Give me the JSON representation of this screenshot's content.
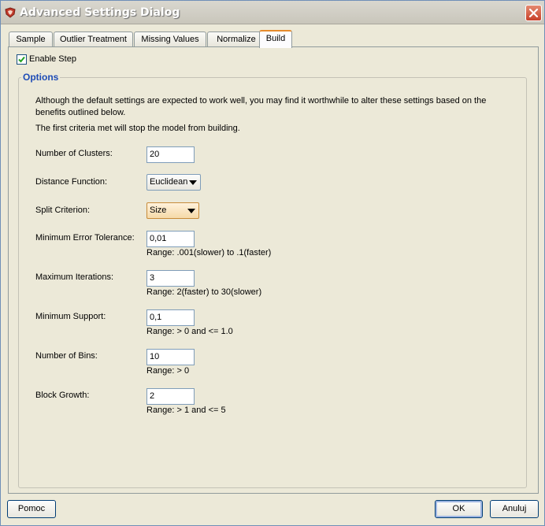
{
  "window": {
    "title": "Advanced Settings Dialog"
  },
  "tabs": [
    {
      "label": "Sample"
    },
    {
      "label": "Outlier Treatment"
    },
    {
      "label": "Missing Values"
    },
    {
      "label": "Normalize"
    },
    {
      "label": "Build",
      "active": true
    }
  ],
  "enable_step": {
    "label": "Enable Step",
    "checked": true
  },
  "options": {
    "title": "Options",
    "intro": "Although the default settings are expected to work well, you may find it worthwhile to alter these settings based on the benefits outlined below.",
    "note": "The first criteria met will stop the model from building.",
    "number_of_clusters": {
      "label": "Number of Clusters:",
      "value": "20"
    },
    "distance_function": {
      "label": "Distance Function:",
      "value": "Euclidean"
    },
    "split_criterion": {
      "label": "Split Criterion:",
      "value": "Size"
    },
    "min_error_tolerance": {
      "label": "Minimum Error Tolerance:",
      "value": "0,01",
      "hint": "Range: .001(slower) to .1(faster)"
    },
    "max_iterations": {
      "label": "Maximum Iterations:",
      "value": "3",
      "hint": "Range: 2(faster) to 30(slower)"
    },
    "min_support": {
      "label": "Minimum Support:",
      "value": "0,1",
      "hint": "Range: > 0 and <= 1.0"
    },
    "number_of_bins": {
      "label": "Number of Bins:",
      "value": "10",
      "hint": "Range: > 0"
    },
    "block_growth": {
      "label": "Block Growth:",
      "value": "2",
      "hint": "Range: > 1 and <= 5"
    }
  },
  "buttons": {
    "help": "Pomoc",
    "ok": "OK",
    "cancel": "Anuluj"
  },
  "icons": {
    "app": "app-logo-icon",
    "close": "close-icon",
    "check": "checkmark-icon",
    "dropdown": "dropdown-arrow-icon"
  },
  "colors": {
    "accent_tab": "#e68b2c",
    "group_title": "#1e4cb6",
    "close_button": "#c8412a"
  }
}
